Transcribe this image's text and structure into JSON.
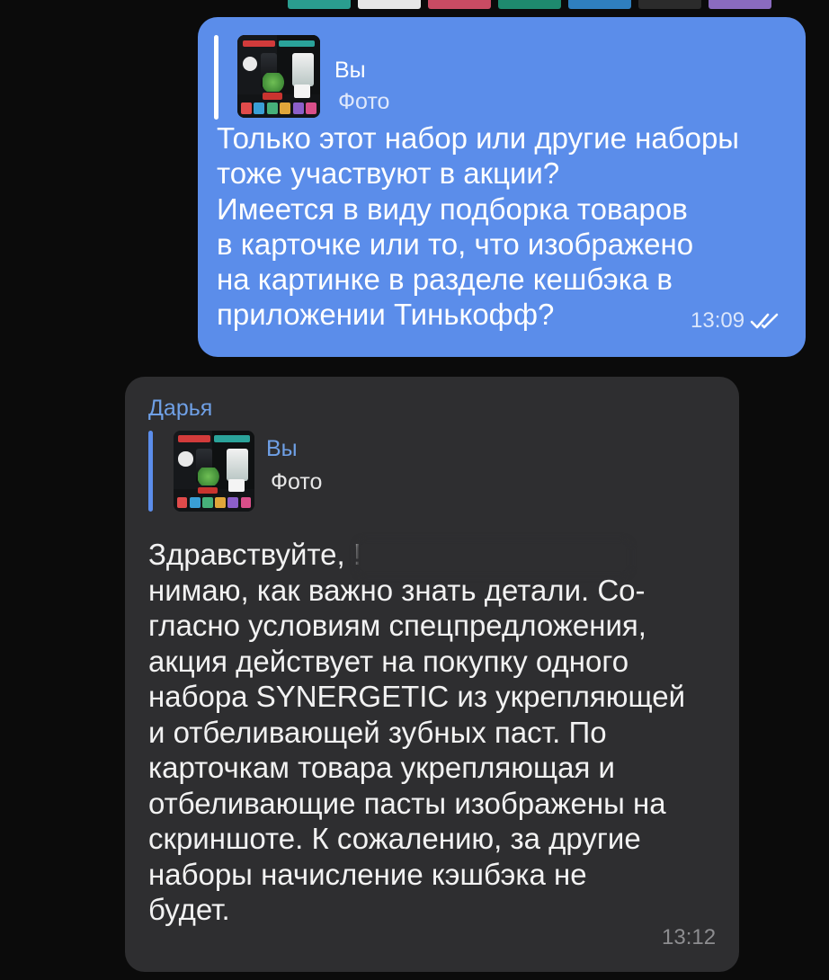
{
  "strip_colors": [
    "#2a9d8f",
    "#e7e7e7",
    "#c94b63",
    "#1e8a6e",
    "#2f7fbf",
    "#2b2b2b",
    "#8a6bbf",
    "#3aa3b5"
  ],
  "outgoing": {
    "reply_author": "Вы",
    "reply_type": "Фото",
    "text": "Только этот набор или другие наборы\nтоже участвуют в акции?\nИмеется в виду подборка товаров\nв карточке или то, что изображено\nна картинке в разделе кешбэка в\nприложении Тинькофф?",
    "time": "13:09",
    "status_icon": "double-check-icon",
    "bubble_color": "#5b8dea"
  },
  "incoming": {
    "sender": "Дарья",
    "reply_author": "Вы",
    "reply_type": "Фото",
    "text": "Здравствуйте,                                     ! По-\nнимаю, как важно знать детали. Со-\nгласно условиям спецпредложения,\nакция действует на покупку одного\nнабора SYNERGETIC из укрепляющей\nи отбеливающей зубных паст. По\nкарточкам товара укрепляющая и\nотбеливающие пасты изображены на\nскриншоте. К сожалению, за другие\nнаборы начисление кэшбэка не\nбудет.",
    "time": "13:12",
    "bubble_color": "#2e2e30"
  },
  "thumbnail_row_colors": [
    "#e04b4b",
    "#3a9fd6",
    "#46b07a",
    "#e0a63a",
    "#8c5fc9",
    "#d94f8a"
  ]
}
